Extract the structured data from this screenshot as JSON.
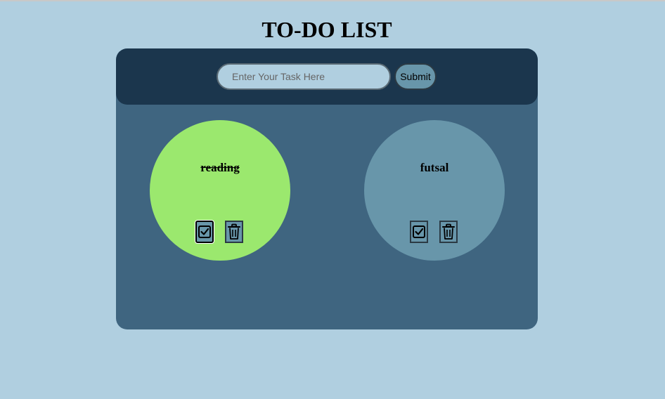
{
  "header": {
    "title": "TO-DO LIST"
  },
  "input_bar": {
    "placeholder": "Enter Your Task Here",
    "value": "",
    "submit_label": "Submit"
  },
  "tasks": [
    {
      "text": "reading",
      "completed": true,
      "color": "#9be86e"
    },
    {
      "text": "futsal",
      "completed": false,
      "color": "#6896aa"
    }
  ],
  "icons": {
    "complete": "check-square-icon",
    "delete": "trash-icon"
  },
  "colors": {
    "page_background": "#b0cfe0",
    "container": "#3f6580",
    "input_bar": "#1b364d",
    "completed_task": "#9be86e",
    "pending_task": "#6896aa"
  }
}
